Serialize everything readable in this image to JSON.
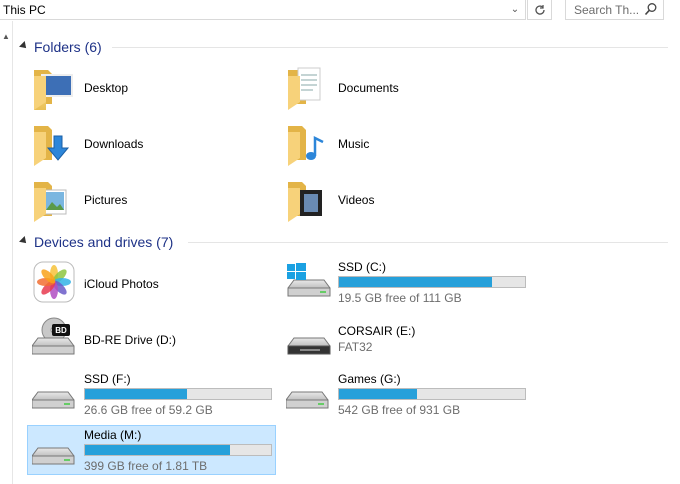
{
  "address": {
    "path": "This PC"
  },
  "search": {
    "placeholder": "Search Th..."
  },
  "sections": {
    "folders": {
      "title": "Folders (6)"
    },
    "devices": {
      "title": "Devices and drives (7)"
    }
  },
  "folders": [
    {
      "label": "Desktop",
      "icon": "desktop-folder-icon"
    },
    {
      "label": "Documents",
      "icon": "documents-folder-icon"
    },
    {
      "label": "Downloads",
      "icon": "downloads-folder-icon"
    },
    {
      "label": "Music",
      "icon": "music-folder-icon"
    },
    {
      "label": "Pictures",
      "icon": "pictures-folder-icon"
    },
    {
      "label": "Videos",
      "icon": "videos-folder-icon"
    }
  ],
  "devices": [
    {
      "label": "iCloud Photos",
      "icon": "icloud-photos-icon"
    },
    {
      "label": "SSD (C:)",
      "free": "19.5 GB free of 111 GB",
      "used_fraction": 0.82,
      "icon": "windows-drive-icon"
    },
    {
      "label": "BD-RE Drive (D:)",
      "icon": "bd-drive-icon"
    },
    {
      "label": "CORSAIR (E:)",
      "free": "FAT32",
      "icon": "removable-drive-icon"
    },
    {
      "label": "SSD (F:)",
      "free": "26.6 GB free of 59.2 GB",
      "used_fraction": 0.55,
      "icon": "hard-drive-icon"
    },
    {
      "label": "Games (G:)",
      "free": "542 GB free of 931 GB",
      "used_fraction": 0.42,
      "icon": "hard-drive-icon"
    },
    {
      "label": "Media (M:)",
      "free": "399 GB free of 1.81 TB",
      "used_fraction": 0.78,
      "icon": "hard-drive-icon"
    }
  ],
  "colors": {
    "bar": "#26a0da",
    "section_title": "#1e3287",
    "selection": "#cce8ff"
  }
}
